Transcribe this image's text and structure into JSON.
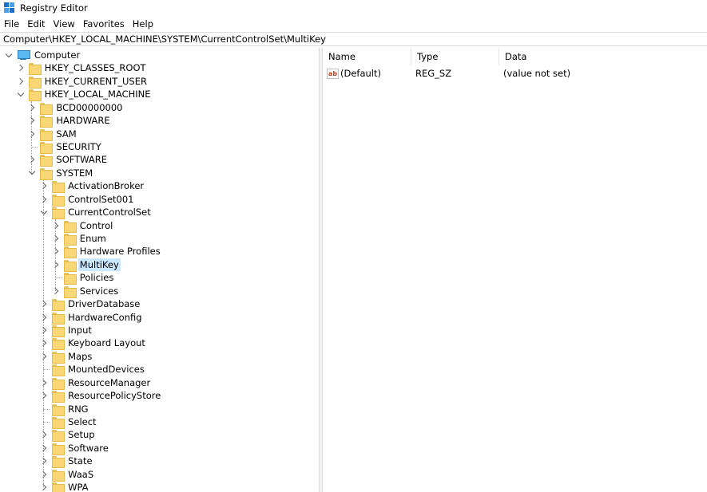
{
  "window": {
    "title": "Registry Editor"
  },
  "menu": [
    "File",
    "Edit",
    "View",
    "Favorites",
    "Help"
  ],
  "address": "Computer\\HKEY_LOCAL_MACHINE\\SYSTEM\\CurrentControlSet\\MultiKey",
  "tree": [
    {
      "label": "Computer",
      "level": 0,
      "expander": "down",
      "icon": "computer-icon"
    },
    {
      "label": "HKEY_CLASSES_ROOT",
      "level": 1,
      "expander": "right",
      "icon": "folder-icon"
    },
    {
      "label": "HKEY_CURRENT_USER",
      "level": 1,
      "expander": "right",
      "icon": "folder-icon"
    },
    {
      "label": "HKEY_LOCAL_MACHINE",
      "level": 1,
      "expander": "down",
      "icon": "folder-icon"
    },
    {
      "label": "BCD00000000",
      "level": 2,
      "expander": "right",
      "icon": "folder-icon"
    },
    {
      "label": "HARDWARE",
      "level": 2,
      "expander": "right",
      "icon": "folder-icon"
    },
    {
      "label": "SAM",
      "level": 2,
      "expander": "right",
      "icon": "folder-icon"
    },
    {
      "label": "SECURITY",
      "level": 2,
      "expander": "none",
      "icon": "folder-icon"
    },
    {
      "label": "SOFTWARE",
      "level": 2,
      "expander": "right",
      "icon": "folder-icon"
    },
    {
      "label": "SYSTEM",
      "level": 2,
      "expander": "down",
      "icon": "folder-icon"
    },
    {
      "label": "ActivationBroker",
      "level": 3,
      "expander": "right",
      "icon": "folder-icon"
    },
    {
      "label": "ControlSet001",
      "level": 3,
      "expander": "right",
      "icon": "folder-icon"
    },
    {
      "label": "CurrentControlSet",
      "level": 3,
      "expander": "down",
      "icon": "folder-icon"
    },
    {
      "label": "Control",
      "level": 4,
      "expander": "right",
      "icon": "folder-icon"
    },
    {
      "label": "Enum",
      "level": 4,
      "expander": "right",
      "icon": "folder-icon"
    },
    {
      "label": "Hardware Profiles",
      "level": 4,
      "expander": "right",
      "icon": "folder-icon"
    },
    {
      "label": "MultiKey",
      "level": 4,
      "expander": "right",
      "icon": "folder-icon",
      "selected": true
    },
    {
      "label": "Policies",
      "level": 4,
      "expander": "none",
      "icon": "folder-icon"
    },
    {
      "label": "Services",
      "level": 4,
      "expander": "right",
      "icon": "folder-icon"
    },
    {
      "label": "DriverDatabase",
      "level": 3,
      "expander": "right",
      "icon": "folder-icon"
    },
    {
      "label": "HardwareConfig",
      "level": 3,
      "expander": "right",
      "icon": "folder-icon"
    },
    {
      "label": "Input",
      "level": 3,
      "expander": "right",
      "icon": "folder-icon"
    },
    {
      "label": "Keyboard Layout",
      "level": 3,
      "expander": "right",
      "icon": "folder-icon"
    },
    {
      "label": "Maps",
      "level": 3,
      "expander": "right",
      "icon": "folder-icon"
    },
    {
      "label": "MountedDevices",
      "level": 3,
      "expander": "none",
      "icon": "folder-icon"
    },
    {
      "label": "ResourceManager",
      "level": 3,
      "expander": "right",
      "icon": "folder-icon"
    },
    {
      "label": "ResourcePolicyStore",
      "level": 3,
      "expander": "right",
      "icon": "folder-icon"
    },
    {
      "label": "RNG",
      "level": 3,
      "expander": "none",
      "icon": "folder-icon"
    },
    {
      "label": "Select",
      "level": 3,
      "expander": "none",
      "icon": "folder-icon"
    },
    {
      "label": "Setup",
      "level": 3,
      "expander": "right",
      "icon": "folder-icon"
    },
    {
      "label": "Software",
      "level": 3,
      "expander": "right",
      "icon": "folder-icon"
    },
    {
      "label": "State",
      "level": 3,
      "expander": "right",
      "icon": "folder-icon"
    },
    {
      "label": "WaaS",
      "level": 3,
      "expander": "right",
      "icon": "folder-icon"
    },
    {
      "label": "WPA",
      "level": 3,
      "expander": "right",
      "icon": "folder-icon"
    }
  ],
  "list": {
    "columns": {
      "name": "Name",
      "type": "Type",
      "data": "Data"
    },
    "rows": [
      {
        "name": "(Default)",
        "type": "REG_SZ",
        "data": "(value not set)",
        "icon": "string-value-icon"
      }
    ]
  },
  "colors": {
    "selection": "#cce8ff",
    "folder": "#f8d774"
  }
}
